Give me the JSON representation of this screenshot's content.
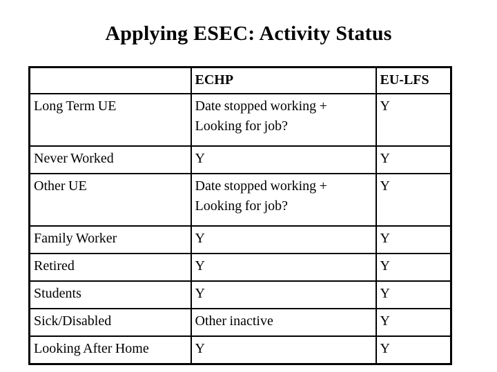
{
  "slide": {
    "title": "Applying ESEC: Activity Status",
    "background_color": "#ffffff",
    "text_color": "#000000"
  },
  "table": {
    "columns": [
      {
        "key": "category",
        "label": ""
      },
      {
        "key": "echp",
        "label": "ECHP"
      },
      {
        "key": "eulfs",
        "label": "EU-LFS"
      }
    ],
    "rows": [
      {
        "category": "Long Term UE",
        "echp": "Date stopped working + Looking for job?",
        "eulfs": "Y",
        "lines": 2
      },
      {
        "category": "Never Worked",
        "echp": "Y",
        "eulfs": "Y",
        "lines": 1
      },
      {
        "category": "Other UE",
        "echp": "Date stopped working + Looking for job?",
        "eulfs": "Y",
        "lines": 2
      },
      {
        "category": "Family Worker",
        "echp": "Y",
        "eulfs": "Y",
        "lines": 1
      },
      {
        "category": "Retired",
        "echp": "Y",
        "eulfs": "Y",
        "lines": 1
      },
      {
        "category": "Students",
        "echp": "Y",
        "eulfs": "Y",
        "lines": 1
      },
      {
        "category": "Sick/Disabled",
        "echp": "Other inactive",
        "eulfs": "Y",
        "lines": 1
      },
      {
        "category": "Looking After Home",
        "echp": "Y",
        "eulfs": "Y",
        "lines": 1
      }
    ]
  }
}
